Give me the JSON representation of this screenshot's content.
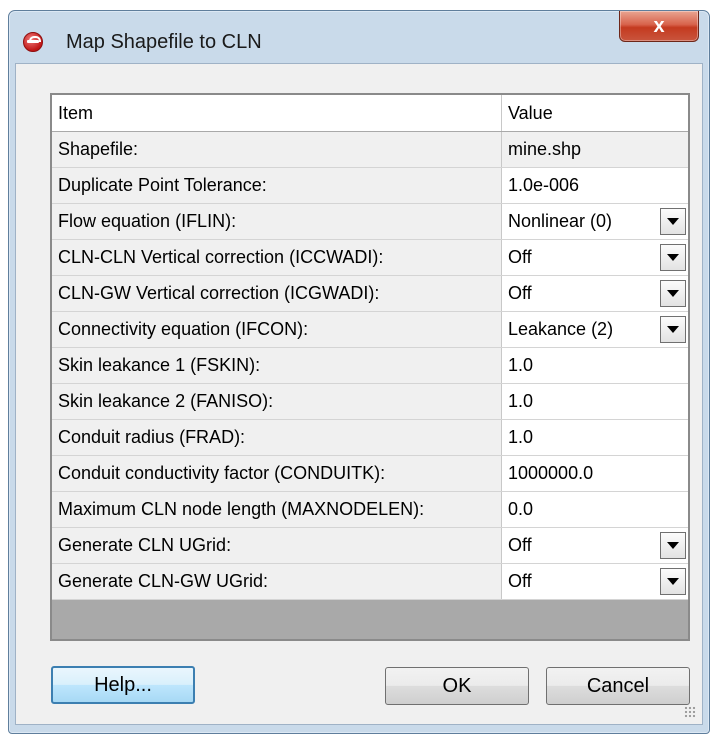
{
  "window": {
    "title": "Map Shapefile to CLN",
    "close_glyph": "x"
  },
  "grid": {
    "headers": {
      "item": "Item",
      "value": "Value"
    },
    "rows": [
      {
        "item": "Shapefile:",
        "value": "mine.shp",
        "kind": "readonly"
      },
      {
        "item": "Duplicate Point Tolerance:",
        "value": "1.0e-006",
        "kind": "text"
      },
      {
        "item": "Flow equation (IFLIN):",
        "value": "Nonlinear (0)",
        "kind": "dropdown"
      },
      {
        "item": "CLN-CLN Vertical correction (ICCWADI):",
        "value": "Off",
        "kind": "dropdown"
      },
      {
        "item": "CLN-GW Vertical correction (ICGWADI):",
        "value": "Off",
        "kind": "dropdown"
      },
      {
        "item": "Connectivity equation (IFCON):",
        "value": "Leakance (2)",
        "kind": "dropdown"
      },
      {
        "item": "Skin leakance 1 (FSKIN):",
        "value": "1.0",
        "kind": "text"
      },
      {
        "item": "Skin leakance 2 (FANISO):",
        "value": "1.0",
        "kind": "text"
      },
      {
        "item": "Conduit radius (FRAD):",
        "value": "1.0",
        "kind": "text"
      },
      {
        "item": "Conduit conductivity factor (CONDUITK):",
        "value": "1000000.0",
        "kind": "text"
      },
      {
        "item": "Maximum CLN node length (MAXNODELEN):",
        "value": "0.0",
        "kind": "text"
      },
      {
        "item": "Generate CLN UGrid:",
        "value": "Off",
        "kind": "dropdown"
      },
      {
        "item": "Generate CLN-GW UGrid:",
        "value": "Off",
        "kind": "dropdown"
      }
    ]
  },
  "buttons": {
    "help": "Help...",
    "ok": "OK",
    "cancel": "Cancel"
  },
  "colors": {
    "frame": "#c9daea",
    "close": "#c9553d",
    "help_border": "#3c7fb1"
  }
}
